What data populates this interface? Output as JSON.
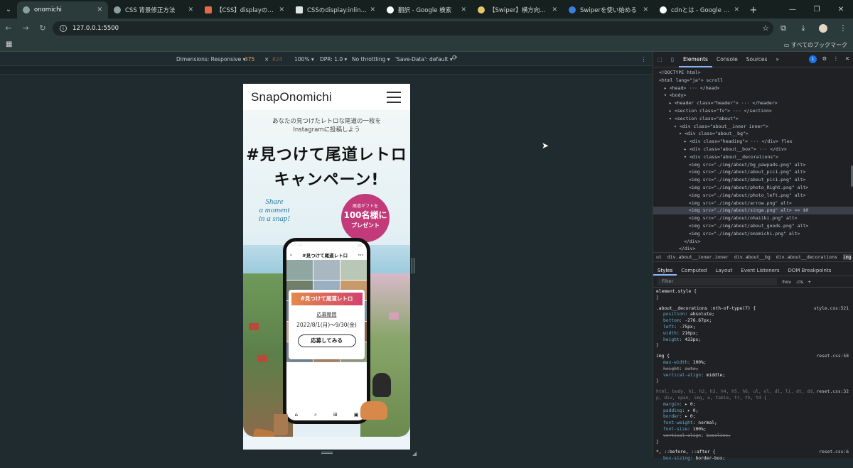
{
  "browser": {
    "tabs": [
      {
        "label": "onomichi",
        "active": true
      },
      {
        "label": "CSS 背景修正方法",
        "active": false
      },
      {
        "label": "【CSS】displayの使い方を網",
        "active": false
      },
      {
        "label": "CSSのdisplay:inline-block",
        "active": false
      },
      {
        "label": "翻訳 - Google 検索",
        "active": false
      },
      {
        "label": "【Swiper】横方向に流れ続",
        "active": false
      },
      {
        "label": "Swiperを使い始める",
        "active": false
      },
      {
        "label": "cdnとは - Google 検索",
        "active": false
      }
    ],
    "url": "127.0.0.1:5500",
    "bookmarks_all": "すべてのブックマーク"
  },
  "device_toolbar": {
    "dimensions_label": "Dimensions: Responsive",
    "width": "375",
    "times": "×",
    "height": "824",
    "zoom": "100%",
    "dpr": "DPR: 1.0",
    "throttle": "No throttling",
    "save_data": "'Save-Data': default"
  },
  "site": {
    "logo": "SnapOnomichi",
    "lead_line1": "あなたの見つけたレトロな尾道の一枚を",
    "lead_line2": "Instagramに投稿しよう",
    "catch_line1": "#見つけて尾道レトロ",
    "catch_line2": "キャンペーン!",
    "share_line1": "Share",
    "share_line2": "a moment",
    "share_line3": "in a snap!",
    "badge_top": "尾道ギフトを",
    "badge_num": "100名様に",
    "badge_bottom": "プレゼント",
    "phone_time": "10:24",
    "phone_title": "#見つけて尾道レトロ",
    "card_tag": "#見つけて尾道レトロ",
    "period_label": "応募期間",
    "period": "2022/8/1(月)〜9/30(金)",
    "apply_button": "応募してみる"
  },
  "devtools": {
    "tabs": [
      "Elements",
      "Console",
      "Sources"
    ],
    "active_tab": "Elements",
    "badge_count": "1",
    "dom_lines": [
      {
        "indent": 0,
        "text": "<!DOCTYPE html>"
      },
      {
        "indent": 0,
        "text": "<html lang=\"ja\"> scroll"
      },
      {
        "indent": 1,
        "text": "▸ <head> ··· </head>"
      },
      {
        "indent": 1,
        "text": "▾ <body>"
      },
      {
        "indent": 2,
        "text": "▸ <header class=\"header\"> ··· </header>"
      },
      {
        "indent": 2,
        "text": "▸ <section class=\"fv\"> ··· </section>"
      },
      {
        "indent": 2,
        "text": "▾ <section class=\"about\">"
      },
      {
        "indent": 3,
        "text": "▾ <div class=\"about__inner inner\">"
      },
      {
        "indent": 4,
        "text": "▾ <div class=\"about__bg\">"
      },
      {
        "indent": 5,
        "text": "▸ <div class=\"heading\"> ··· </div> flex"
      },
      {
        "indent": 5,
        "text": "▸ <div class=\"about__box\"> ··· </div>"
      },
      {
        "indent": 5,
        "text": "▾ <div class=\"about__decorations\">"
      },
      {
        "indent": 6,
        "text": "<img src=\"./img/about/bg_pawpads.png\" alt>"
      },
      {
        "indent": 6,
        "text": "<img src=\"./img/about/about_pic1.png\" alt>"
      },
      {
        "indent": 6,
        "text": "<img src=\"./img/about/about_pic1.png\" alt>"
      },
      {
        "indent": 6,
        "text": "<img src=\"./img/about/photo_Right.png\" alt>"
      },
      {
        "indent": 6,
        "text": "<img src=\"./img/about/photo_left.png\" alt>"
      },
      {
        "indent": 6,
        "text": "<img src=\"./img/about/arrow.png\" alt>"
      },
      {
        "indent": 6,
        "text": "<img src=\"./img/about/singe.png\" alt> == $0",
        "selected": true
      },
      {
        "indent": 6,
        "text": "<img src=\"./img/about/ohaiiki.png\" alt>"
      },
      {
        "indent": 6,
        "text": "<img src=\"./img/about/about_goods.png\" alt>"
      },
      {
        "indent": 6,
        "text": "<img src=\"./img/about/onomichi.png\" alt>"
      },
      {
        "indent": 5,
        "text": "</div>"
      },
      {
        "indent": 4,
        "text": "</div>"
      }
    ],
    "breadcrumb": [
      "ut",
      "div.about__inner.inner",
      "div.about__bg",
      "div.about__decorations",
      "img"
    ],
    "styles_tabs": [
      "Styles",
      "Computed",
      "Layout",
      "Event Listeners",
      "DOM Breakpoints"
    ],
    "filter_placeholder": "Filter",
    "filter_hov": ":hov",
    "filter_cls": ".cls",
    "rules": [
      {
        "selector": "element.style {",
        "source": "",
        "decls": [],
        "close": "}"
      },
      {
        "selector": ".about__decorations :nth-of-type(7) {",
        "source": "style.css:521",
        "decls": [
          {
            "p": "position",
            "v": "absolute;"
          },
          {
            "p": "bottom",
            "v": "-276.67px;"
          },
          {
            "p": "left",
            "v": "-75px;"
          },
          {
            "p": "width",
            "v": "216px;"
          },
          {
            "p": "height",
            "v": "433px;"
          }
        ],
        "close": "}"
      },
      {
        "selector": "img {",
        "source": "reset.css:58",
        "decls": [
          {
            "p": "max-width",
            "v": "100%;"
          },
          {
            "p": "height",
            "v": "auto;",
            "strike": true
          },
          {
            "p": "vertical-align",
            "v": "middle;"
          }
        ],
        "close": "}"
      },
      {
        "selector": "html, body, h1, h2, h3, h4, h5, h6, ul, ol, dl, li, dt, dd, p, div, span, img, a, table, tr, th, td {",
        "source": "reset.css:32",
        "decls": [
          {
            "p": "margin",
            "v": "▸ 0;"
          },
          {
            "p": "padding",
            "v": "▸ 0;"
          },
          {
            "p": "border",
            "v": "▸ 0;"
          },
          {
            "p": "font-weight",
            "v": "normal;"
          },
          {
            "p": "font-size",
            "v": "100%;"
          },
          {
            "p": "vertical-align",
            "v": "baseline;",
            "strike": true
          }
        ],
        "close": "}"
      },
      {
        "selector": "*, ::before, ::after {",
        "source": "reset.css:6",
        "decls": [
          {
            "p": "box-sizing",
            "v": "border-box;"
          }
        ],
        "close": ""
      }
    ]
  }
}
